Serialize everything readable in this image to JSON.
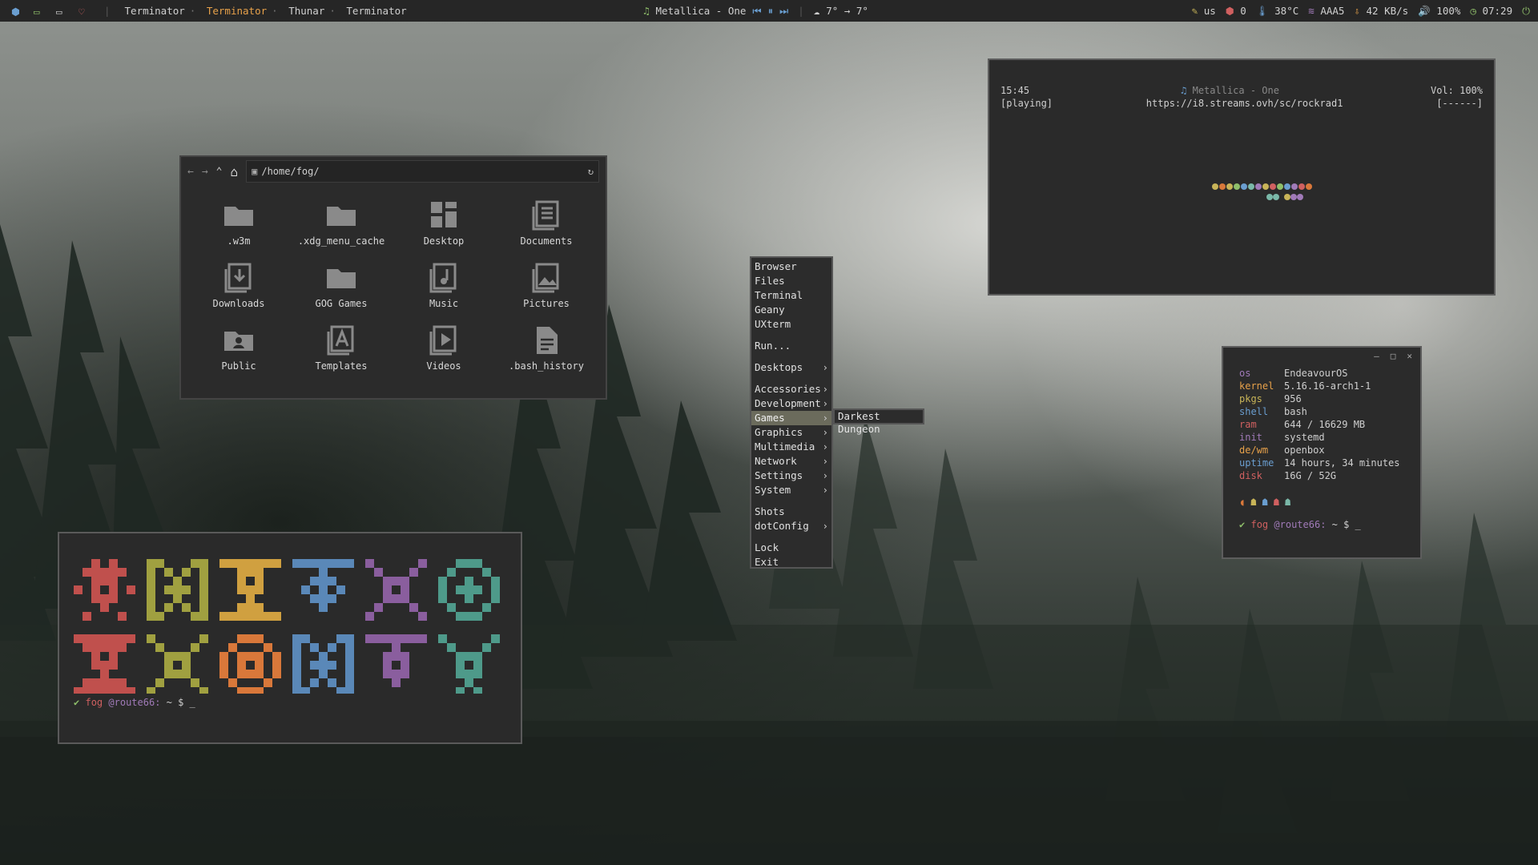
{
  "topbar": {
    "tasks": [
      "Terminator",
      "Terminator",
      "Thunar",
      "Terminator"
    ],
    "active_task_index": 1,
    "music": "Metallica - One",
    "weather": "7° → 7°",
    "keyboard": "us",
    "updates": "0",
    "temp": "38°C",
    "wifi": "AAA5",
    "net": "42 KB/s",
    "volume": "100%",
    "time": "07:29"
  },
  "file_manager": {
    "path": "/home/fog/",
    "items": [
      {
        "label": ".w3m",
        "icon": "folder-icon"
      },
      {
        "label": ".xdg_menu_cache",
        "icon": "folder-icon"
      },
      {
        "label": "Desktop",
        "icon": "desktop-folder-icon"
      },
      {
        "label": "Documents",
        "icon": "documents-folder-icon"
      },
      {
        "label": "Downloads",
        "icon": "downloads-folder-icon"
      },
      {
        "label": "GOG Games",
        "icon": "folder-icon"
      },
      {
        "label": "Music",
        "icon": "music-folder-icon"
      },
      {
        "label": "Pictures",
        "icon": "pictures-folder-icon"
      },
      {
        "label": "Public",
        "icon": "public-folder-icon"
      },
      {
        "label": "Templates",
        "icon": "templates-folder-icon"
      },
      {
        "label": "Videos",
        "icon": "videos-folder-icon"
      },
      {
        "label": ".bash_history",
        "icon": "text-file-icon"
      }
    ]
  },
  "player": {
    "time": "15:45",
    "state": "[playing]",
    "title": "Metallica - One",
    "url": "https://i8.streams.ovh/sc/rockrad1",
    "volume": "Vol: 100%",
    "progress": "[------]"
  },
  "menu": {
    "items": [
      {
        "label": "Browser"
      },
      {
        "label": "Files"
      },
      {
        "label": "Terminal"
      },
      {
        "label": "Geany"
      },
      {
        "label": "UXterm"
      },
      {
        "label": "Run..."
      },
      {
        "label": "Desktops"
      },
      {
        "label": "Accessories"
      },
      {
        "label": "Development"
      },
      {
        "label": "Games"
      },
      {
        "label": "Graphics"
      },
      {
        "label": "Multimedia"
      },
      {
        "label": "Network"
      },
      {
        "label": "Settings"
      },
      {
        "label": "System"
      },
      {
        "label": "Shots"
      },
      {
        "label": "dotConfig"
      },
      {
        "label": "Lock"
      },
      {
        "label": "Exit"
      }
    ],
    "selected": "Games",
    "submenu_item": "Darkest Dungeon"
  },
  "sysinfo": {
    "rows": [
      {
        "key": "os",
        "value": "EndeavourOS"
      },
      {
        "key": "kernel",
        "value": "5.16.16-arch1-1"
      },
      {
        "key": "pkgs",
        "value": "956"
      },
      {
        "key": "shell",
        "value": "bash"
      },
      {
        "key": "ram",
        "value": "644 / 16629 MB"
      },
      {
        "key": "init",
        "value": "systemd"
      },
      {
        "key": "de/wm",
        "value": "openbox"
      },
      {
        "key": "uptime",
        "value": "14 hours, 34 minutes"
      },
      {
        "key": "disk",
        "value": "16G / 52G"
      }
    ]
  },
  "prompt": {
    "check": "✔",
    "user": "fog",
    "host": "@route66:",
    "tail": "~ $ _"
  },
  "colors": {
    "accent": "#e7a14a",
    "red": "#c0504d",
    "olive": "#a0a040",
    "gold": "#d0a040",
    "blue": "#5a88b8",
    "purple": "#8a5e9e",
    "teal": "#4e9a8a",
    "orange": "#d9783a"
  }
}
